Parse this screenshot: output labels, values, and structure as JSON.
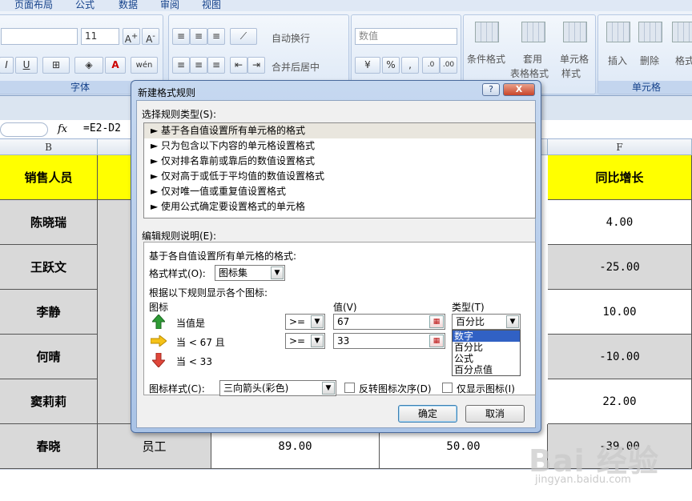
{
  "ribbon": {
    "tabs": [
      "页面布局",
      "公式",
      "数据",
      "审阅",
      "视图"
    ],
    "font_size": "11",
    "number_format": "数值",
    "wrap_text": "自动换行",
    "merge_center": "合并后居中",
    "percent": "%",
    "comma": ",",
    "conditional_format": "条件格式",
    "table_format_1": "套用",
    "table_format_2": "表格格式",
    "cell_style_1": "单元格",
    "cell_style_2": "样式",
    "insert": "插入",
    "delete": "删除",
    "format": "格式",
    "group_font": "字体",
    "group_cells": "单元格"
  },
  "formula_bar": {
    "fx": "fx",
    "formula": "=E2-D2"
  },
  "sheet": {
    "col_b": "B",
    "col_f": "F",
    "header_b": "销售人员",
    "header_f": "同比增长",
    "rows": [
      {
        "name": "陈晓瑞",
        "growth": "4.00"
      },
      {
        "name": "王跃文",
        "growth": "-25.00"
      },
      {
        "name": "李静",
        "growth": "10.00"
      },
      {
        "name": "何晴",
        "growth": "-10.00"
      },
      {
        "name": "窦莉莉",
        "growth": "22.00"
      },
      {
        "name": "春晓",
        "growth": "-39.00"
      }
    ],
    "last_row_c": "员工",
    "last_row_d": "89.00",
    "last_row_e": "50.00"
  },
  "dialog": {
    "title": "新建格式规则",
    "help": "?",
    "close": "X",
    "select_rule_type": "选择规则类型(S):",
    "rule_types": [
      "► 基于各自值设置所有单元格的格式",
      "► 只为包含以下内容的单元格设置格式",
      "► 仅对排名靠前或靠后的数值设置格式",
      "► 仅对高于或低于平均值的数值设置格式",
      "► 仅对唯一值或重复值设置格式",
      "► 使用公式确定要设置格式的单元格"
    ],
    "edit_rule_desc": "编辑规则说明(E):",
    "format_all_cells": "基于各自值设置所有单元格的格式:",
    "format_style_label": "格式样式(O):",
    "format_style_value": "图标集",
    "show_icons_by_rule": "根据以下规则显示各个图标:",
    "col_icon": "图标",
    "col_value": "值(V)",
    "col_type": "类型(T)",
    "rule1_label": "当值是",
    "rule1_op": ">=",
    "rule1_value": "67",
    "rule1_type": "百分比",
    "rule2_label": "当 < 67 且",
    "rule2_op": ">=",
    "rule2_value": "33",
    "rule3_label": "当 < 33",
    "type_options": [
      "数字",
      "百分比",
      "公式",
      "百分点值"
    ],
    "icon_style_label": "图标样式(C):",
    "icon_style_value": "三向箭头(彩色)",
    "reverse_icon_order": "反转图标次序(D)",
    "show_icon_only": "仅显示图标(I)",
    "ok": "确定",
    "cancel": "取消"
  },
  "watermark": {
    "brand": "Bai 经验",
    "url": "jingyan.baidu.com"
  }
}
